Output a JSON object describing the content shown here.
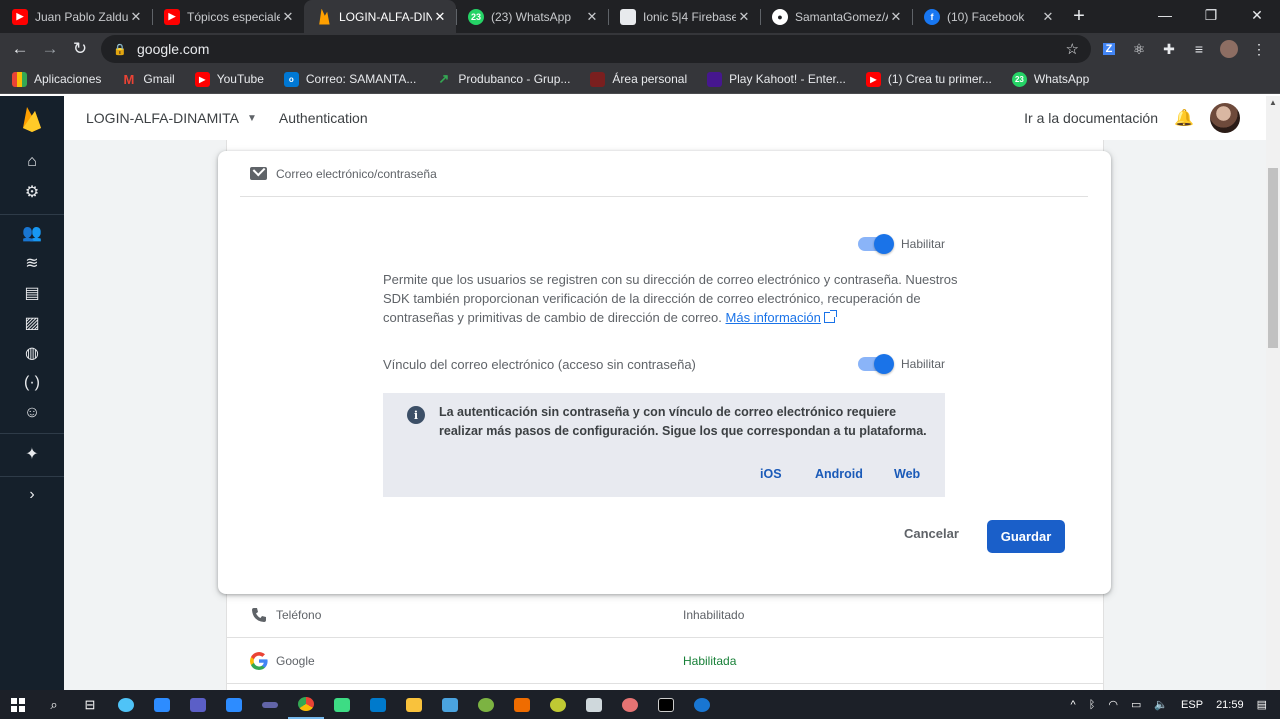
{
  "browser": {
    "tabs": [
      {
        "title": "Juan Pablo Zaldum",
        "icon": "youtube-icon",
        "color": "#ff0000"
      },
      {
        "title": "Tópicos especiales",
        "icon": "youtube-icon",
        "color": "#ff0000"
      },
      {
        "title": "LOGIN-ALFA-DINA",
        "icon": "firebase-icon",
        "color": "#ffa000",
        "active": true
      },
      {
        "title": "(23) WhatsApp",
        "icon": "whatsapp-icon",
        "color": "#25d366",
        "badge": "23"
      },
      {
        "title": "Ionic 5|4 Firebase",
        "icon": "tab-favicon-icon",
        "color": "#c8c8c8"
      },
      {
        "title": "SamantaGomez/A",
        "icon": "github-icon",
        "color": "#24292e"
      },
      {
        "title": "(10) Facebook",
        "icon": "facebook-icon",
        "color": "#1877f2"
      }
    ],
    "new_tab": "+",
    "url": "google.com",
    "bookmarks": [
      {
        "label": "Aplicaciones",
        "color": "#ea4335"
      },
      {
        "label": "Gmail",
        "color": "#ea4335",
        "glyph": "M"
      },
      {
        "label": "YouTube",
        "color": "#ff0000"
      },
      {
        "label": "Correo: SAMANTA...",
        "color": "#0078d4",
        "glyph": "o"
      },
      {
        "label": "Produbanco - Grup...",
        "color": "#1b8a3f"
      },
      {
        "label": "Área personal",
        "color": "#7a1f1f"
      },
      {
        "label": "Play Kahoot! - Enter...",
        "color": "#46178f"
      },
      {
        "label": "(1) Crea tu primer...",
        "color": "#ff0000"
      },
      {
        "label": "WhatsApp",
        "color": "#25d366",
        "glyph": "23"
      }
    ]
  },
  "console": {
    "project": "LOGIN-ALFA-DINAMITA",
    "section": "Authentication",
    "doc_link": "Ir a la documentación",
    "sidebar_icons": [
      "home-icon",
      "gear-icon",
      "users-icon",
      "realtime-icon",
      "database-icon",
      "storage-icon",
      "hosting-icon",
      "functions-icon",
      "ml-icon",
      "extensions-icon",
      "expand-icon"
    ]
  },
  "provider_card": {
    "title": "Correo electrónico/contraseña",
    "toggle1_label": "Habilitar",
    "description": "Permite que los usuarios se registren con su dirección de correo electrónico y contraseña. Nuestros SDK también proporcionan verificación de la dirección de correo electrónico, recuperación de contraseñas y primitivas de cambio de dirección de correo.",
    "more_info": "Más información",
    "link_option": "Vínculo del correo electrónico (acceso sin contraseña)",
    "toggle2_label": "Habilitar",
    "info_text": "La autenticación sin contraseña y con vínculo de correo electrónico requiere realizar más pasos de configuración. Sigue los que correspondan a tu plataforma.",
    "platforms": [
      "iOS",
      "Android",
      "Web"
    ],
    "cancel": "Cancelar",
    "save": "Guardar"
  },
  "providers": [
    {
      "name": "Teléfono",
      "status": "Inhabilitado",
      "enabled": false
    },
    {
      "name": "Google",
      "status": "Habilitada",
      "enabled": true
    }
  ],
  "taskbar": {
    "language": "ESP",
    "time": "21:59"
  },
  "colors": {
    "accent": "#1a73e8",
    "save_button": "#1a5fc9",
    "sidebar": "#15202b",
    "enabled_status": "#188038"
  }
}
